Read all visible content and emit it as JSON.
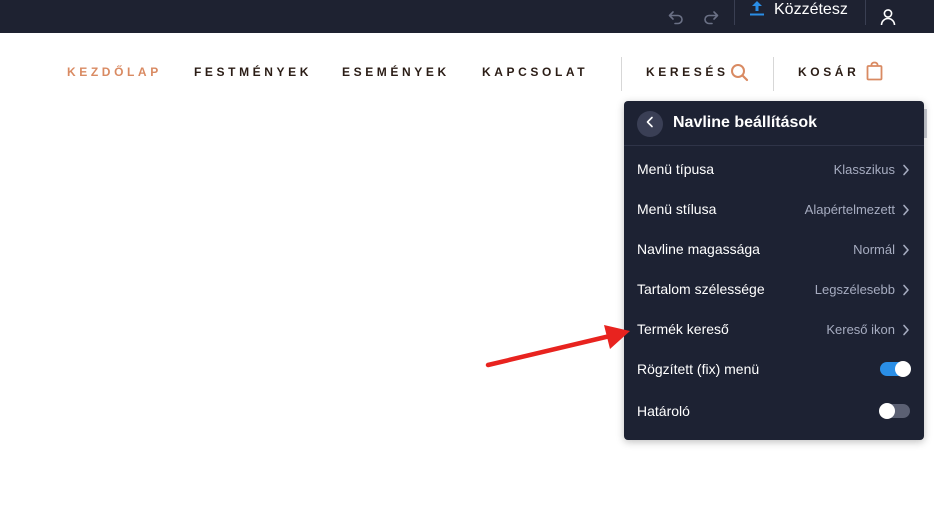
{
  "topbar": {
    "publish_label": "Közzétesz",
    "colors": {
      "background": "#1e2231",
      "publish_icon": "#2a8ee6"
    },
    "icons": [
      "undo-icon",
      "redo-icon",
      "upload-icon",
      "user-icon"
    ]
  },
  "nav": {
    "links": [
      {
        "label": "KEZDŐLAP",
        "active": true
      },
      {
        "label": "FESTMÉNYEK",
        "active": false
      },
      {
        "label": "ESEMÉNYEK",
        "active": false
      },
      {
        "label": "KAPCSOLAT",
        "active": false
      }
    ],
    "search_label": "KERESÉS",
    "cart_label": "KOSÁR",
    "colors": {
      "accent": "#d98a62",
      "text": "#2b1d16"
    },
    "icons": [
      "search-icon",
      "shopping-bag-icon"
    ]
  },
  "panel": {
    "title": "Navline beállítások",
    "rows": [
      {
        "label": "Menü típusa",
        "value": "Klasszikus"
      },
      {
        "label": "Menü stílusa",
        "value": "Alapértelmezett"
      },
      {
        "label": "Navline magassága",
        "value": "Normál"
      },
      {
        "label": "Tartalom szélessége",
        "value": "Legszélesebb"
      },
      {
        "label": "Termék kereső",
        "value": "Kereső ikon"
      }
    ],
    "toggles": [
      {
        "label": "Rögzített (fix) menü",
        "on": true
      },
      {
        "label": "Határoló",
        "on": false
      }
    ],
    "colors": {
      "background": "#1d2233",
      "toggle_on": "#2a8ee6",
      "toggle_off": "#5b6073",
      "value_text": "#a6acc0"
    }
  },
  "annotation": {
    "arrow_color": "#e8231f"
  }
}
